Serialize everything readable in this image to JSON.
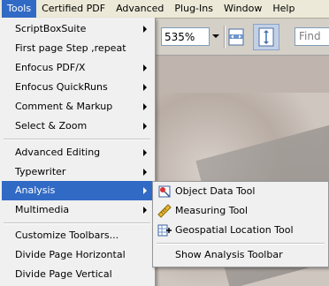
{
  "menubar": {
    "items": [
      {
        "label": "Tools"
      },
      {
        "label": "Certified PDF"
      },
      {
        "label": "Advanced"
      },
      {
        "label": "Plug-Ins"
      },
      {
        "label": "Window"
      },
      {
        "label": "Help"
      }
    ]
  },
  "toolbar": {
    "zoom_value": "535%",
    "find_placeholder": "Find"
  },
  "tools_menu": {
    "items": [
      {
        "label": "ScriptBoxSuite"
      },
      {
        "label": "First page Step ,repeat"
      },
      {
        "label": "Enfocus PDF/X"
      },
      {
        "label": "Enfocus QuickRuns"
      },
      {
        "label": "Comment & Markup"
      },
      {
        "label": "Select & Zoom"
      },
      {
        "label": "Advanced Editing"
      },
      {
        "label": "Typewriter"
      },
      {
        "label": "Analysis"
      },
      {
        "label": "Multimedia"
      },
      {
        "label": "Customize Toolbars..."
      },
      {
        "label": "Divide Page Horizontal"
      },
      {
        "label": "Divide Page Vertical"
      }
    ]
  },
  "analysis_submenu": {
    "items": [
      {
        "label": "Object Data Tool",
        "icon": "object-data-icon"
      },
      {
        "label": "Measuring Tool",
        "icon": "ruler-icon"
      },
      {
        "label": "Geospatial Location Tool",
        "icon": "geospatial-location-icon"
      },
      {
        "label": "Show Analysis Toolbar"
      }
    ]
  },
  "colors": {
    "highlight": "#316ac5",
    "menu_bg": "#f0f0f0",
    "menubar_bg": "#ece9d8"
  }
}
